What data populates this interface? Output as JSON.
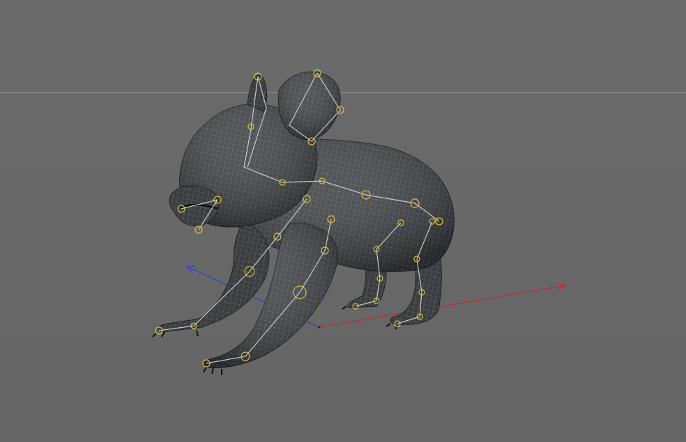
{
  "viewport": {
    "background_color": "#6b6b6b",
    "axis_colors": {
      "x": "#c8282a",
      "y": "#2a9a2a",
      "z": "#2f3ed0"
    },
    "object": {
      "icon": "koala-mesh",
      "mesh_color": "#3b3d41",
      "wire_color": "#8a8d92",
      "rig_joint_color": "#d4c33a",
      "rig_bone_color": "#d6d6d6"
    }
  }
}
